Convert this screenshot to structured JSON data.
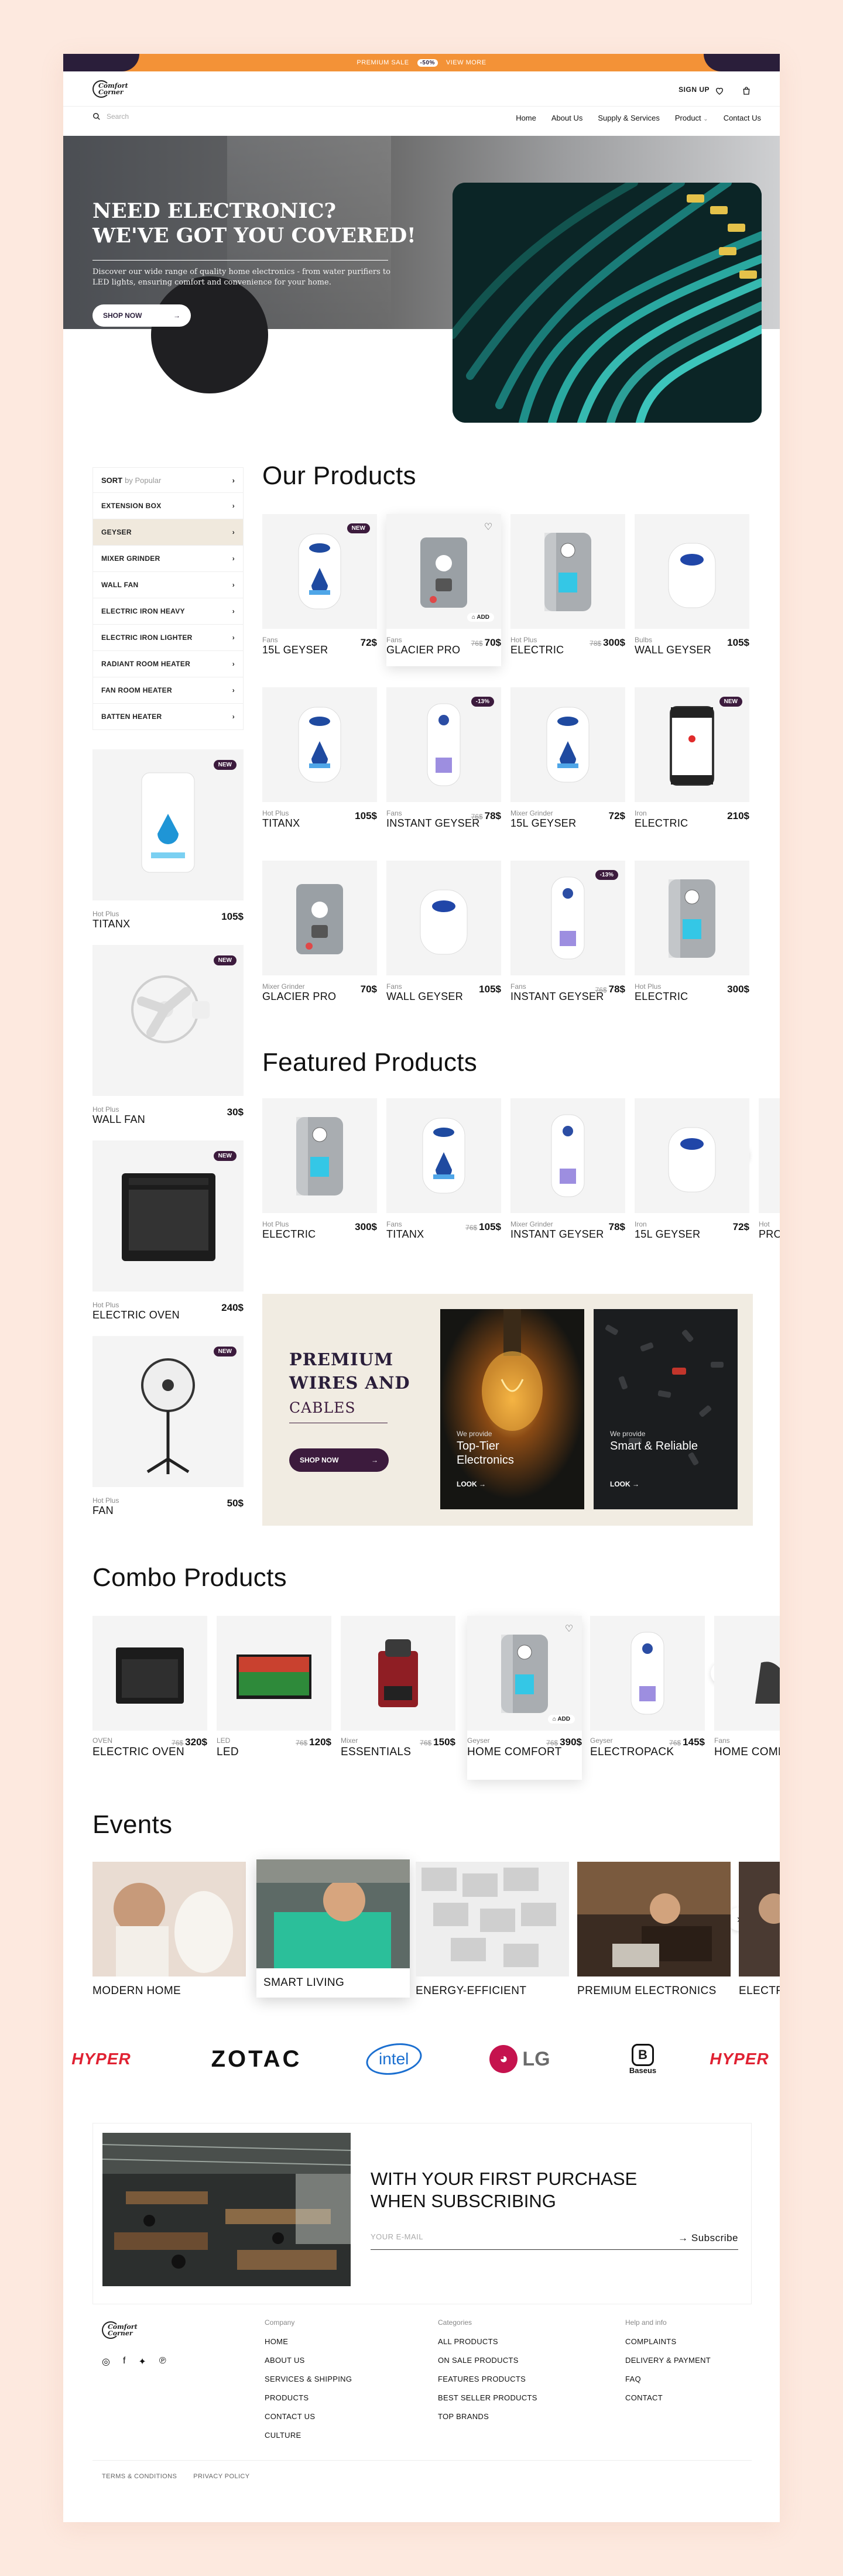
{
  "promo": {
    "text": "PREMIUM SALE",
    "badge": "-50%",
    "link": "VIEW MORE"
  },
  "header": {
    "logo_line1": "Comfort",
    "logo_line2": "Corner",
    "signup": "SIGN UP",
    "wishlist_count": "0"
  },
  "nav": {
    "search_placeholder": "Search",
    "items": [
      "Home",
      "About Us",
      "Supply & Services",
      "Product",
      "Contact Us"
    ]
  },
  "hero": {
    "title_line1": "NEED ELECTRONIC?",
    "title_line2": "WE'VE GOT YOU COVERED!",
    "text": "Discover our wide range of quality home electronics - from water purifiers to LED lights, ensuring comfort and convenience for your home.",
    "cta": "SHOP NOW"
  },
  "sidebar": {
    "sort_label": "SORT",
    "sort_value": "by Popular",
    "items": [
      "EXTENSION BOX",
      "GEYSER",
      "MIXER GRINDER",
      "WALL FAN",
      "ELECTRIC IRON HEAVY",
      "ELECTRIC IRON LIGHTER",
      "RADIANT ROOM HEATER",
      "FAN ROOM HEATER",
      "BATTEN HEATER"
    ],
    "active": "GEYSER",
    "cards": [
      {
        "tag": "NEW",
        "category": "Hot Plus",
        "name": "TITANX",
        "price": "105$"
      },
      {
        "tag": "NEW",
        "category": "Hot Plus",
        "name": "WALL FAN",
        "price": "30$"
      },
      {
        "tag": "NEW",
        "category": "Hot Plus",
        "name": "ELECTRIC OVEN",
        "price": "240$"
      },
      {
        "tag": "NEW",
        "category": "Hot Plus",
        "name": "FAN",
        "price": "50$"
      }
    ]
  },
  "our_products": {
    "title": "Our Products",
    "add_label": "ADD",
    "items": [
      {
        "category": "Fans",
        "name": "15L GEYSER",
        "old": "",
        "price": "72$",
        "tag": "NEW"
      },
      {
        "category": "Fans",
        "name": "GLACIER PRO",
        "old": "76$",
        "price": "70$",
        "tag": ""
      },
      {
        "category": "Hot Plus",
        "name": "ELECTRIC",
        "old": "78$",
        "price": "300$",
        "tag": ""
      },
      {
        "category": "Bulbs",
        "name": "WALL GEYSER",
        "old": "",
        "price": "105$",
        "tag": ""
      },
      {
        "category": "Hot Plus",
        "name": "TITANX",
        "old": "",
        "price": "105$",
        "tag": ""
      },
      {
        "category": "Fans",
        "name": "INSTANT GEYSER",
        "old": "76$",
        "price": "78$",
        "tag": "-13%"
      },
      {
        "category": "Mixer Grinder",
        "name": "15L GEYSER",
        "old": "",
        "price": "72$",
        "tag": ""
      },
      {
        "category": "Iron",
        "name": "ELECTRIC",
        "old": "",
        "price": "210$",
        "tag": "NEW"
      },
      {
        "category": "Mixer Grinder",
        "name": "GLACIER PRO",
        "old": "",
        "price": "70$",
        "tag": ""
      },
      {
        "category": "Fans",
        "name": "WALL GEYSER",
        "old": "",
        "price": "105$",
        "tag": ""
      },
      {
        "category": "Fans",
        "name": "INSTANT GEYSER",
        "old": "76$",
        "price": "78$",
        "tag": "-13%"
      },
      {
        "category": "Hot Plus",
        "name": "ELECTRIC",
        "old": "",
        "price": "300$",
        "tag": ""
      }
    ]
  },
  "featured": {
    "title": "Featured Products",
    "items": [
      {
        "category": "Hot Plus",
        "name": "ELECTRIC",
        "old": "",
        "price": "300$"
      },
      {
        "category": "Fans",
        "name": "TITANX",
        "old": "76$",
        "price": "105$"
      },
      {
        "category": "Mixer Grinder",
        "name": "INSTANT GEYSER",
        "old": "",
        "price": "78$"
      },
      {
        "category": "Iron",
        "name": "15L GEYSER",
        "old": "",
        "price": "72$"
      },
      {
        "category": "Hot",
        "name": "PRO",
        "old": "",
        "price": ""
      }
    ]
  },
  "premium": {
    "title": "PREMIUM WIRES AND",
    "sub": "CABLES",
    "cta": "SHOP NOW",
    "cards": [
      {
        "small": "We provide",
        "big": "Top-Tier Electronics",
        "look": "LOOK"
      },
      {
        "small": "We provide",
        "big": "Smart & Reliable",
        "look": "LOOK"
      }
    ]
  },
  "combo": {
    "title": "Combo Products",
    "items": [
      {
        "category": "OVEN",
        "name": "ELECTRIC OVEN",
        "old": "76$",
        "price": "320$"
      },
      {
        "category": "LED",
        "name": "LED",
        "old": "76$",
        "price": "120$"
      },
      {
        "category": "Mixer",
        "name": "ESSENTIALS",
        "old": "76$",
        "price": "150$"
      },
      {
        "category": "Geyser",
        "name": "HOME COMFORT",
        "old": "76$",
        "price": "390$"
      },
      {
        "category": "Geyser",
        "name": "ELECTROPACK",
        "old": "76$",
        "price": "145$"
      },
      {
        "category": "Fans",
        "name": "HOME COMFORT",
        "old": "",
        "price": ""
      }
    ]
  },
  "events": {
    "title": "Events",
    "items": [
      "MODERN HOME",
      "SMART LIVING",
      "ENERGY-EFFICIENT",
      "PREMIUM ELECTRONICS",
      "ELECTRONICS"
    ]
  },
  "brands": [
    "HYPER",
    "ZOTAC",
    "intel",
    "LG",
    "Baseus",
    "HYPER"
  ],
  "subscribe": {
    "title": "WITH YOUR FIRST PURCHASE WHEN SUBSCRIBING",
    "placeholder": "YOUR E-MAIL",
    "button": "Subscribe"
  },
  "footer": {
    "company": {
      "heading": "Company",
      "links": [
        "HOME",
        "ABOUT US",
        "SERVICES & SHIPPING",
        "PRODUCTS",
        "CONTACT US",
        "CULTURE"
      ]
    },
    "categories": {
      "heading": "Categories",
      "links": [
        "ALL PRODUCTS",
        "ON SALE PRODUCTS",
        "FEATURES PRODUCTS",
        "BEST SELLER PRODUCTS",
        "TOP BRANDS"
      ]
    },
    "help": {
      "heading": "Help and info",
      "links": [
        "COMPLAINTS",
        "DELIVERY & PAYMENT",
        "FAQ",
        "CONTACT"
      ]
    },
    "bottom": [
      "TERMS & CONDITIONS",
      "PRIVACY POLICY"
    ]
  },
  "colors": {
    "accent": "#f39237",
    "brand": "#3c1b3d",
    "background": "#fde9df"
  }
}
